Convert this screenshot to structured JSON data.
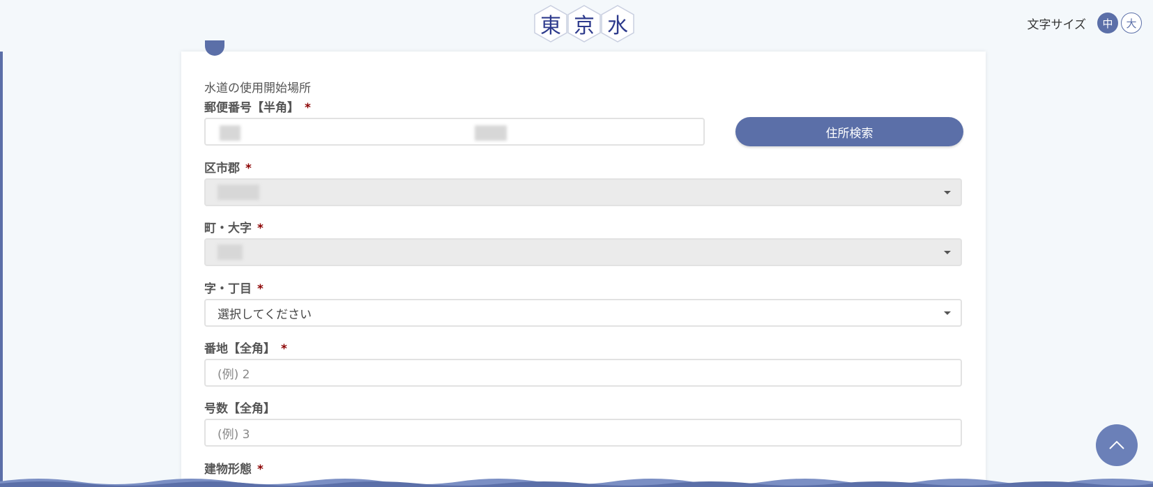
{
  "header": {
    "logo_chars": [
      "東",
      "京",
      "水"
    ],
    "font_size_label": "文字サイズ",
    "font_size_medium": "中",
    "font_size_large": "大"
  },
  "form": {
    "section_title": "水道の使用開始場所",
    "postal_label": "郵便番号【半角】",
    "postal_required": "*",
    "address_search_button": "住所検索",
    "ward_label": "区市郡",
    "ward_required": "*",
    "town_label": "町・大字",
    "town_required": "*",
    "chome_label": "字・丁目",
    "chome_required": "*",
    "chome_value": "選択してください",
    "banchi_label": "番地【全角】",
    "banchi_required": "*",
    "banchi_placeholder": "(例) 2",
    "gou_label": "号数【全角】",
    "gou_placeholder": "(例) 3",
    "building_label": "建物形態",
    "building_required": "*"
  },
  "colors": {
    "accent": "#5b6fa8",
    "required": "#8b0000",
    "disabled_field": "#ebebeb"
  }
}
